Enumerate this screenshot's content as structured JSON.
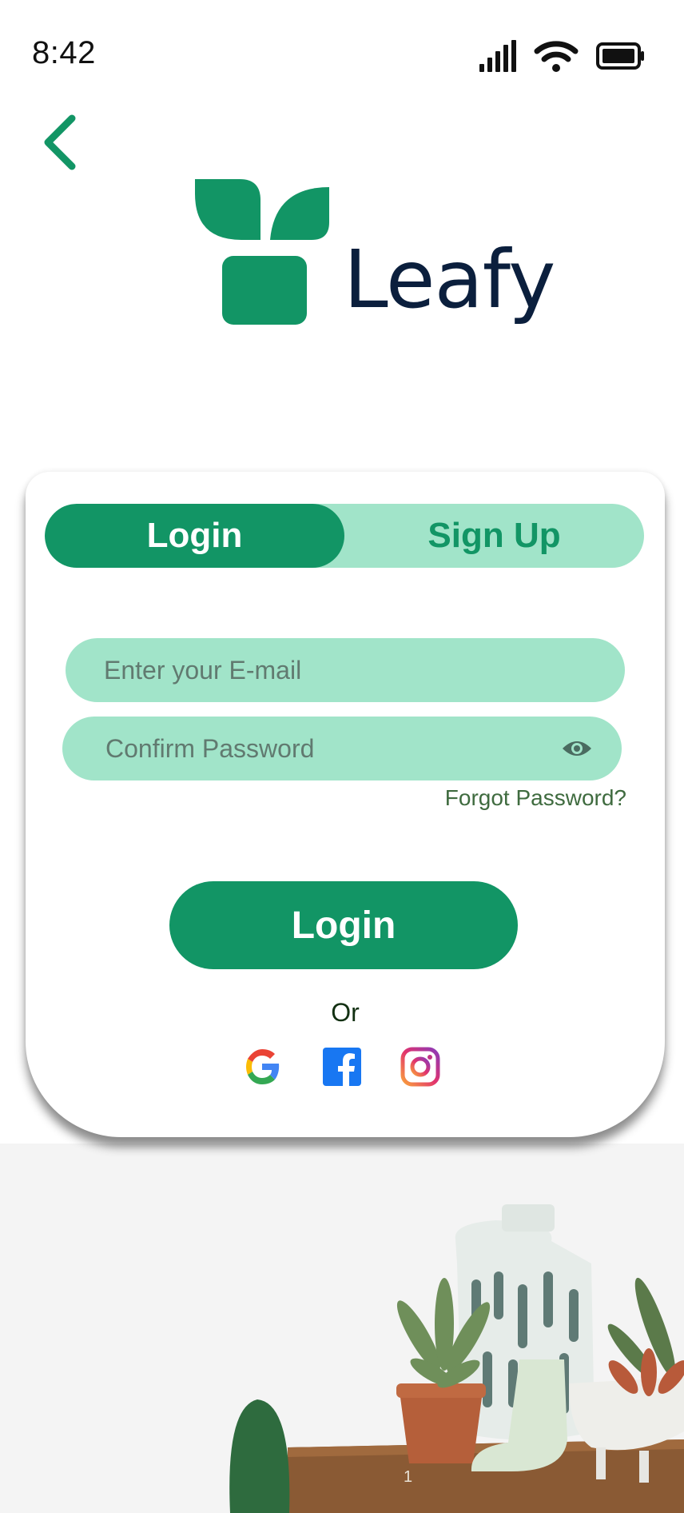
{
  "status_bar": {
    "time": "8:42"
  },
  "brand": {
    "name": "Leafy"
  },
  "tabs": {
    "login": "Login",
    "signup": "Sign Up"
  },
  "form": {
    "email_placeholder": "Enter your E-mail",
    "password_placeholder": "Confirm Password",
    "forgot_password": "Forgot Password?",
    "login_button": "Login",
    "or_text": "Or"
  },
  "social": [
    "google-icon",
    "facebook-icon",
    "instagram-icon"
  ],
  "page_number": "1",
  "colors": {
    "primary_green": "#129565",
    "light_green": "#a1e4c9",
    "brand_text": "#0b1f3d",
    "forgot_text": "#3f6b3f"
  }
}
